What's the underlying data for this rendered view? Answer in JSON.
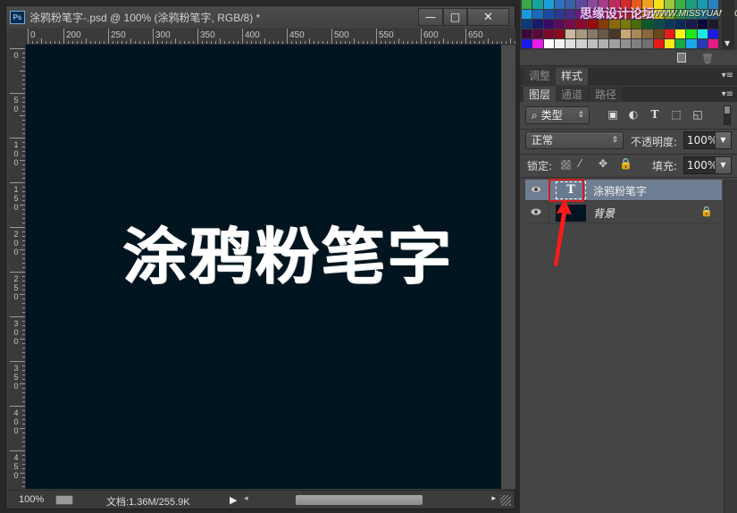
{
  "document": {
    "app_icon": "Ps",
    "title": "涂鸦粉笔字-.psd @ 100% (涂鸦粉笔字, RGB/8) *",
    "window_buttons": {
      "minimize": "—",
      "maximize": "□",
      "close": "✕"
    },
    "ruler_h_labels": [
      "0",
      "200",
      "250",
      "300",
      "350",
      "400",
      "450",
      "500",
      "550",
      "600",
      "650"
    ],
    "ruler_v_labels": [
      "0",
      "50",
      "100",
      "150",
      "200",
      "250",
      "300",
      "350",
      "400",
      "450"
    ],
    "canvas_text": "涂鸦粉笔字",
    "canvas_bg": "#011520",
    "status": {
      "zoom": "100%",
      "doc_info": "文档:1.36M/255.9K",
      "arrow": "▶",
      "scroll_left": "◂",
      "scroll_right": "▸"
    }
  },
  "swatches": {
    "watermark": "思缘设计论坛",
    "watermark_url": "WWW.MISSYUAN.COM",
    "rows": [
      [
        "#3aa84a",
        "#13a39a",
        "#1aa0d8",
        "#2e6fc0",
        "#3a5fa8",
        "#5c4aa0",
        "#8a4a9a",
        "#a83a8a",
        "#c02a5a",
        "#d42a2a",
        "#e85a1a",
        "#f0a01a",
        "#f5e01a",
        "#9ac83a",
        "#3ab04a",
        "#1aa07a",
        "#1a9ab0",
        "#2a80c0"
      ],
      [
        "#1a9ae0",
        "#1a6ab8",
        "#1a4aa0",
        "#2a3a90",
        "#4a2a88",
        "#6a1a80",
        "#8a1a70",
        "#a01a5a",
        "#b01a3a",
        "#c01a1a",
        "#c84a1a",
        "#c8881a",
        "#c8b81a",
        "#78a02a",
        "#2a8a3a",
        "#1a7a6a",
        "#1a6a8a",
        "#1a4a7a"
      ],
      [
        "#0a3a7a",
        "#1a1a6a",
        "#3a0a6a",
        "#5a0a5a",
        "#7a0a4a",
        "#8a0a2a",
        "#9a0a0a",
        "#8a3a0a",
        "#8a6a0a",
        "#7a7a0a",
        "#4a6a0a",
        "#0a5a2a",
        "#0a4a4a",
        "#0a3a5a",
        "#0a2a5a",
        "#1a1a4a",
        "#0a0a3a",
        "#1a1a2a"
      ],
      [
        "#3a0a3a",
        "#5a0a3a",
        "#7a0a2a",
        "#8a0a1a",
        "#c8b8a0",
        "#a89880",
        "#887868",
        "#685848",
        "#483828",
        "#c8a870",
        "#a88858",
        "#886838",
        "#684818",
        "#e81a1a",
        "#f8f81a",
        "#1ae81a",
        "#1ae8e8",
        "#1a1ae8"
      ],
      [
        "#1a1ae8",
        "#e81ae8",
        "#ffffff",
        "#f0f0f0",
        "#e0e0e0",
        "#d0d0d0",
        "#c0c0c0",
        "#b0b0b0",
        "#a0a0a0",
        "#909090",
        "#808080",
        "#707070",
        "#e81a1a",
        "#f8e81a",
        "#1aa84a",
        "#1aa8e8",
        "#2a3ab8",
        "#e81a88"
      ]
    ]
  },
  "panels": {
    "top_tabs": [
      {
        "label": "调整",
        "active": false
      },
      {
        "label": "样式",
        "active": true
      }
    ],
    "layers_tabs": [
      {
        "label": "图层",
        "active": true
      },
      {
        "label": "通道",
        "active": false
      },
      {
        "label": "路径",
        "active": false
      }
    ],
    "menu_icon": "▾≡",
    "filter": {
      "kind_label": "类型",
      "search_icon": "⌕",
      "icons": [
        "image-filter",
        "adjustment-filter",
        "type-filter",
        "shape-filter",
        "smart-object-filter"
      ]
    },
    "blend_mode": "正常",
    "opacity_label": "不透明度:",
    "opacity_value": "100%",
    "lock_label": "锁定:",
    "fill_label": "填充:",
    "fill_value": "100%",
    "layers": [
      {
        "name": "涂鸦粉笔字",
        "type": "text",
        "thumb_glyph": "T",
        "selected": true,
        "locked": false,
        "italic": false
      },
      {
        "name": "背景",
        "type": "background",
        "thumb_glyph": "",
        "selected": false,
        "locked": true,
        "italic": true
      }
    ]
  },
  "annotation": {
    "arrow_color": "#ff1a1a",
    "box_color": "#d01c1c"
  }
}
